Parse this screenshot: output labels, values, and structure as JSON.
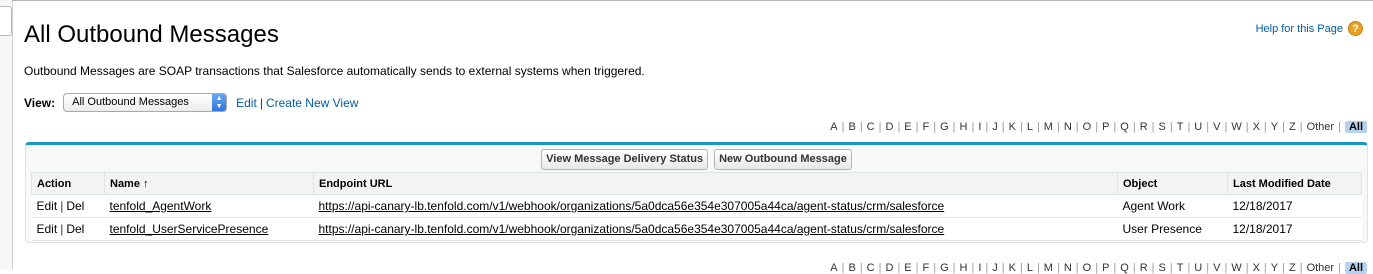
{
  "page": {
    "title": "All Outbound Messages",
    "help_link": "Help for this Page",
    "help_icon": "?",
    "description": "Outbound Messages are SOAP transactions that Salesforce automatically sends to external systems when triggered."
  },
  "view": {
    "label": "View:",
    "selected": "All Outbound Messages",
    "edit_label": "Edit",
    "separator": "|",
    "create_label": "Create New View"
  },
  "alpha": {
    "letters": [
      "A",
      "B",
      "C",
      "D",
      "E",
      "F",
      "G",
      "H",
      "I",
      "J",
      "K",
      "L",
      "M",
      "N",
      "O",
      "P",
      "Q",
      "R",
      "S",
      "T",
      "U",
      "V",
      "W",
      "X",
      "Y",
      "Z",
      "Other",
      "All"
    ],
    "active": "All"
  },
  "buttons": {
    "delivery_status": "View Message Delivery Status",
    "new_message": "New Outbound Message"
  },
  "table": {
    "headers": {
      "action": "Action",
      "name": "Name",
      "sort_indicator": "↑",
      "endpoint": "Endpoint URL",
      "object": "Object",
      "modified": "Last Modified Date"
    },
    "edit_label": "Edit",
    "del_label": "Del",
    "rows": [
      {
        "name": "tenfold_AgentWork",
        "endpoint": "https://api-canary-lb.tenfold.com/v1/webhook/organizations/5a0dca56e354e307005a44ca/agent-status/crm/salesforce",
        "object": "Agent Work",
        "modified": "12/18/2017"
      },
      {
        "name": "tenfold_UserServicePresence",
        "endpoint": "https://api-canary-lb.tenfold.com/v1/webhook/organizations/5a0dca56e354e307005a44ca/agent-status/crm/salesforce",
        "object": "User Presence",
        "modified": "12/18/2017"
      }
    ]
  },
  "colors": {
    "link": "#015ba7",
    "list_accent": "#1797c0",
    "help_icon": "#e8a022",
    "alpha_active_bg": "#b6d2ee"
  }
}
